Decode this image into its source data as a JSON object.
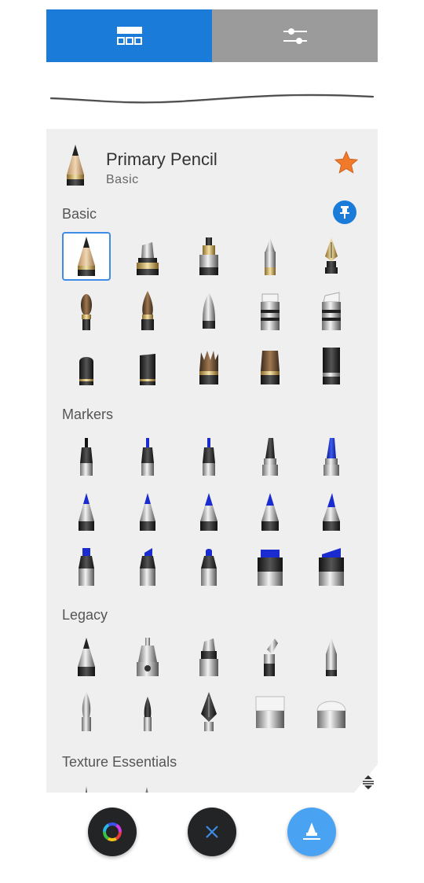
{
  "tabs": [
    {
      "name": "brush-library-tab",
      "icon": "grid-icon",
      "active": true
    },
    {
      "name": "brush-properties-tab",
      "icon": "sliders-icon",
      "active": false
    }
  ],
  "current_brush": {
    "name": "Primary Pencil",
    "category": "Basic",
    "favorite": true
  },
  "sections": {
    "basic": "Basic",
    "markers": "Markers",
    "legacy": "Legacy",
    "texture": "Texture Essentials"
  },
  "colors": {
    "accent": "#1a7bd8",
    "star": "#f07a2a",
    "panel": "#efefef",
    "tab_inactive": "#9b9b9b",
    "fab_blue": "#4aa3f2"
  },
  "bottom_buttons": [
    {
      "name": "color-picker-button",
      "icon": "color-wheel-icon"
    },
    {
      "name": "close-button",
      "icon": "close-icon"
    },
    {
      "name": "brush-button",
      "icon": "brush-icon"
    }
  ]
}
